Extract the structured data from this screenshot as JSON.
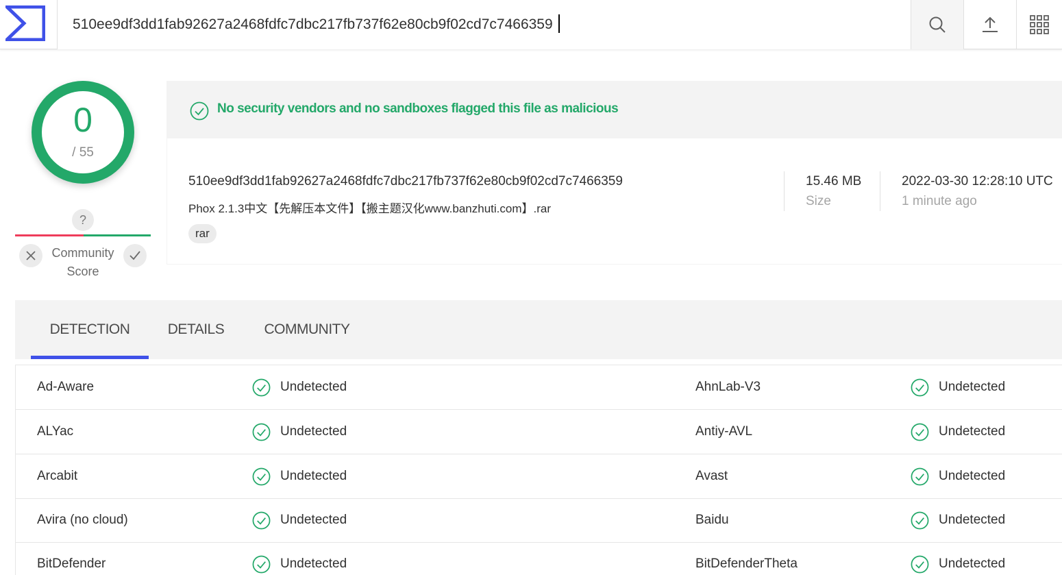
{
  "search": {
    "value": "510ee9df3dd1fab92627a2468fdfc7dbc217fb737f62e80cb9f02cd7c7466359"
  },
  "score": {
    "detections": "0",
    "total": "/ 55"
  },
  "community": {
    "question": "?",
    "label": "Community Score"
  },
  "banner": {
    "message": "No security vendors and no sandboxes flagged this file as malicious"
  },
  "file": {
    "hash": "510ee9df3dd1fab92627a2468fdfc7dbc217fb737f62e80cb9f02cd7c7466359",
    "name": "Phox 2.1.3中文【先解压本文件】【搬主题汉化www.banzhuti.com】.rar",
    "tag": "rar",
    "size": "15.46 MB",
    "size_label": "Size",
    "date": "2022-03-30 12:28:10 UTC",
    "date_relative": "1 minute ago"
  },
  "tabs": [
    {
      "label": "DETECTION"
    },
    {
      "label": "DETAILS"
    },
    {
      "label": "COMMUNITY"
    }
  ],
  "results": [
    {
      "left": {
        "engine": "Ad-Aware",
        "status": "Undetected"
      },
      "right": {
        "engine": "AhnLab-V3",
        "status": "Undetected"
      }
    },
    {
      "left": {
        "engine": "ALYac",
        "status": "Undetected"
      },
      "right": {
        "engine": "Antiy-AVL",
        "status": "Undetected"
      }
    },
    {
      "left": {
        "engine": "Arcabit",
        "status": "Undetected"
      },
      "right": {
        "engine": "Avast",
        "status": "Undetected"
      }
    },
    {
      "left": {
        "engine": "Avira (no cloud)",
        "status": "Undetected"
      },
      "right": {
        "engine": "Baidu",
        "status": "Undetected"
      }
    },
    {
      "left": {
        "engine": "BitDefender",
        "status": "Undetected"
      },
      "right": {
        "engine": "BitDefenderTheta",
        "status": "Undetected"
      }
    }
  ],
  "colors": {
    "clean": "#23a869",
    "malicious": "#ef3d5b",
    "accent": "#3f51e8"
  },
  "icons": [
    "virustotal-logo-icon",
    "search-icon",
    "upload-icon",
    "apps-grid-icon",
    "check-circle-icon",
    "close-icon",
    "check-icon"
  ]
}
